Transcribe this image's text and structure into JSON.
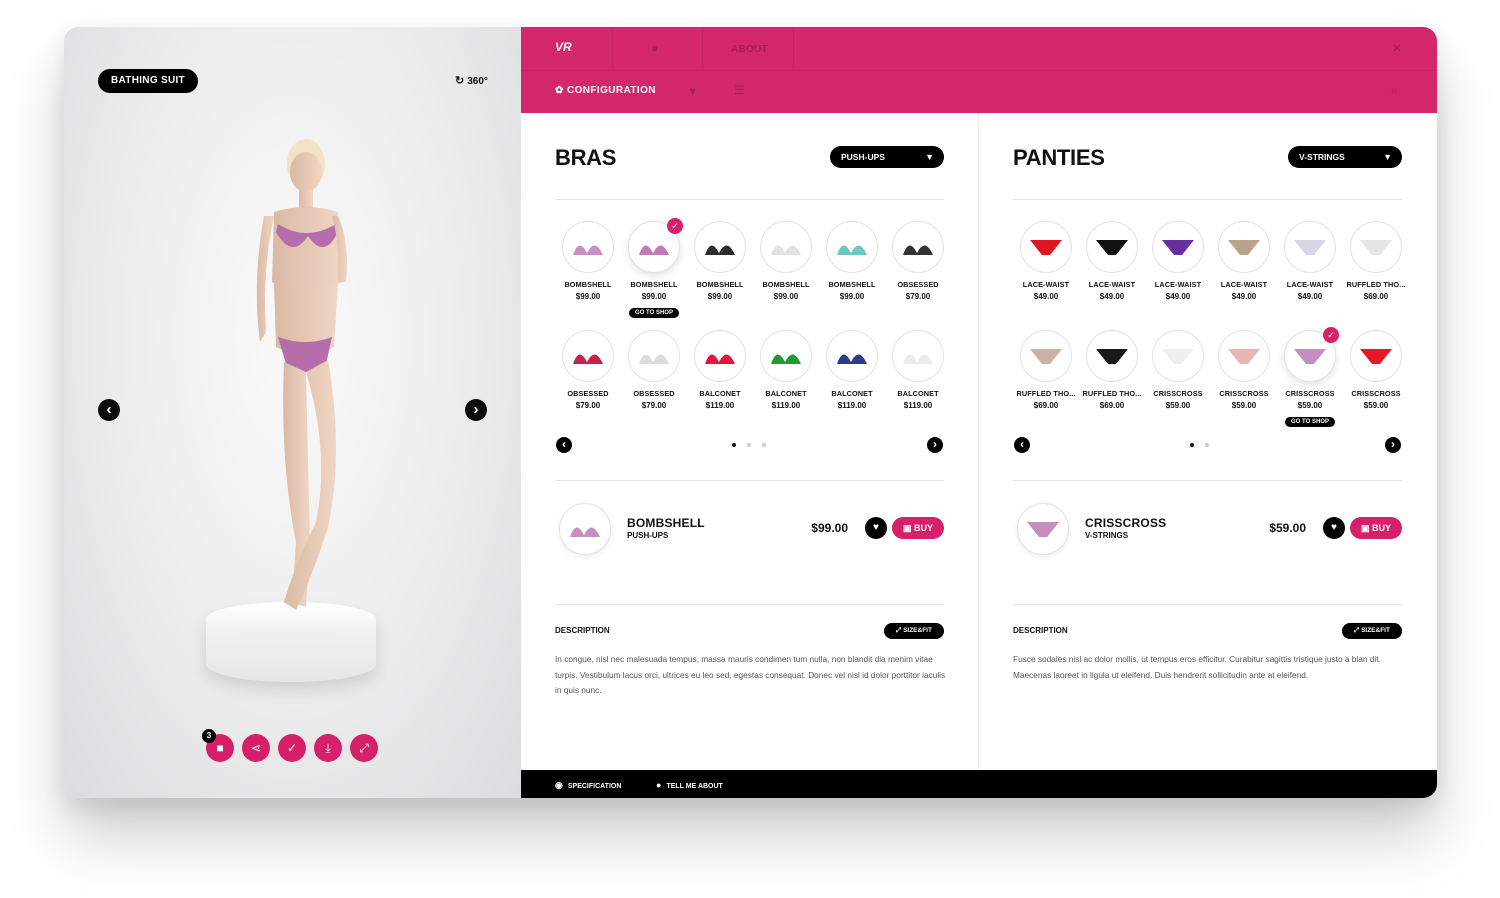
{
  "viewer": {
    "mode_label": "BATHING SUIT",
    "rotate_label": "360°",
    "notification_count": "3",
    "tools": [
      "camera-icon",
      "share-icon",
      "thumbs-up-icon",
      "download-icon",
      "expand-icon"
    ]
  },
  "topbar": {
    "logo": "VR",
    "tab_about": "ABOUT",
    "close_label": "✕",
    "config_label": "CONFIGURATION"
  },
  "bras": {
    "title": "BRAS",
    "filter": "PUSH-UPS",
    "items": [
      {
        "name": "BOMBSHELL",
        "price": "$99.00",
        "color": "#c88fc4",
        "selected": false
      },
      {
        "name": "BOMBSHELL",
        "price": "$99.00",
        "color": "#c07cb8",
        "selected": true,
        "shop": "GO TO SHOP"
      },
      {
        "name": "BOMBSHELL",
        "price": "$99.00",
        "color": "#2d2d2d",
        "selected": false
      },
      {
        "name": "BOMBSHELL",
        "price": "$99.00",
        "color": "#e2e2e2",
        "selected": false
      },
      {
        "name": "BOMBSHELL",
        "price": "$99.00",
        "color": "#6cc9bf",
        "selected": false
      },
      {
        "name": "OBSESSED",
        "price": "$79.00",
        "color": "#333333",
        "selected": false
      },
      {
        "name": "OBSESSED",
        "price": "$79.00",
        "color": "#c8224b",
        "selected": false
      },
      {
        "name": "OBSESSED",
        "price": "$79.00",
        "color": "#dcdcdc",
        "selected": false
      },
      {
        "name": "BALCONET",
        "price": "$119.00",
        "color": "#e3153f",
        "selected": false
      },
      {
        "name": "BALCONET",
        "price": "$119.00",
        "color": "#1f9b2f",
        "selected": false
      },
      {
        "name": "BALCONET",
        "price": "$119.00",
        "color": "#2d3b8c",
        "selected": false
      },
      {
        "name": "BALCONET",
        "price": "$119.00",
        "color": "#ececec",
        "selected": false
      }
    ],
    "selected": {
      "name": "BOMBSHELL",
      "sub": "PUSH-UPS",
      "price": "$99.00",
      "buy": "BUY",
      "color": "#c88fc4"
    },
    "desc_title": "DESCRIPTION",
    "sizefit": "SIZE&FIT",
    "description": "In congue, nisl nec malesuada tempus, massa mauris condimen tum nulla, non blandit dia menim vitae turpis. Vestibulum lacus orci, ultrices eu leo sed, egestas consequat. Donec vel nisl id dolor porttitor iaculis in quis nunc."
  },
  "panties": {
    "title": "PANTIES",
    "filter": "V-STRINGS",
    "items": [
      {
        "name": "LACE-WAIST",
        "price": "$49.00",
        "color": "#e11623",
        "selected": false
      },
      {
        "name": "LACE-WAIST",
        "price": "$49.00",
        "color": "#111111",
        "selected": false
      },
      {
        "name": "LACE-WAIST",
        "price": "$49.00",
        "color": "#6a2f9e",
        "selected": false
      },
      {
        "name": "LACE-WAIST",
        "price": "$49.00",
        "color": "#b9a48a",
        "selected": false
      },
      {
        "name": "LACE-WAIST",
        "price": "$49.00",
        "color": "#d6d6e6",
        "selected": false
      },
      {
        "name": "RUFFLED THO...",
        "price": "$69.00",
        "color": "#e6e6e6",
        "selected": false
      },
      {
        "name": "RUFFLED THO...",
        "price": "$69.00",
        "color": "#cbb3a3",
        "selected": false
      },
      {
        "name": "RUFFLED THO...",
        "price": "$69.00",
        "color": "#1a1a1a",
        "selected": false
      },
      {
        "name": "CRISSCROSS",
        "price": "$59.00",
        "color": "#f0f0f0",
        "selected": false
      },
      {
        "name": "CRISSCROSS",
        "price": "$59.00",
        "color": "#e8b6b0",
        "selected": false
      },
      {
        "name": "CRISSCROSS",
        "price": "$59.00",
        "color": "#c48fbe",
        "selected": true,
        "shop": "GO TO SHOP"
      },
      {
        "name": "CRISSCROSS",
        "price": "$59.00",
        "color": "#e8182a",
        "selected": false
      }
    ],
    "selected": {
      "name": "CRISSCROSS",
      "sub": "V-STRINGS",
      "price": "$59.00",
      "buy": "BUY",
      "color": "#c48fbe"
    },
    "desc_title": "DESCRIPTION",
    "sizefit": "SIZE&FIT",
    "description": "Fusce sodales nisl ac dolor mollis, ut tempus eros efficitur. Curabitur sagittis tristique justo a blan dit. Maecenas laoreet in ligula ut eleifend. Duis hendrerit sollicitudin ante at eleifend."
  },
  "bottombar": {
    "specification": "SPECIFICATION",
    "tell_me": "TELL ME ABOUT"
  },
  "colors": {
    "accent": "#d2276b",
    "dark": "#000000"
  }
}
